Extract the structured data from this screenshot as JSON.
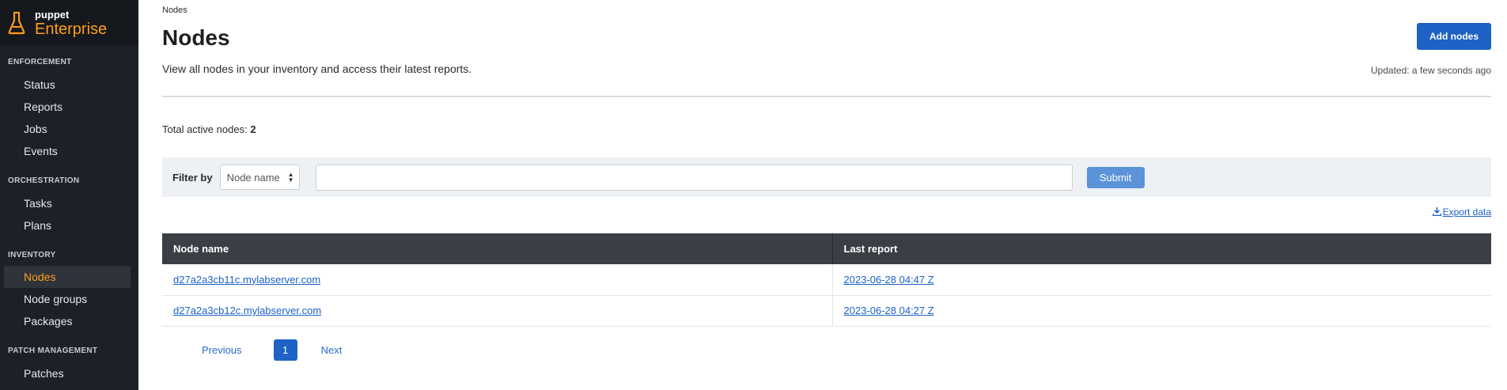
{
  "brand": {
    "small": "puppet",
    "big": "Enterprise",
    "accent": "#ff9c1a"
  },
  "sidebar": {
    "sections": [
      {
        "title": "ENFORCEMENT",
        "items": [
          "Status",
          "Reports",
          "Jobs",
          "Events"
        ]
      },
      {
        "title": "ORCHESTRATION",
        "items": [
          "Tasks",
          "Plans"
        ]
      },
      {
        "title": "INVENTORY",
        "items": [
          "Nodes",
          "Node groups",
          "Packages"
        ]
      },
      {
        "title": "PATCH MANAGEMENT",
        "items": [
          "Patches"
        ]
      }
    ],
    "active_item": "Nodes"
  },
  "header": {
    "breadcrumb": "Nodes",
    "title": "Nodes",
    "description": "View all nodes in your inventory and access their latest reports.",
    "add_button": "Add nodes",
    "updated": "Updated: a few seconds ago"
  },
  "summary": {
    "label": "Total active nodes:",
    "count": "2"
  },
  "filter": {
    "label": "Filter by",
    "select_value": "Node name",
    "input_value": "",
    "submit": "Submit"
  },
  "export_label": "Export data",
  "table": {
    "columns": [
      "Node name",
      "Last report"
    ],
    "rows": [
      [
        "d27a2a3cb11c.mylabserver.com",
        "2023-06-28 04:47 Z"
      ],
      [
        "d27a2a3cb12c.mylabserver.com",
        "2023-06-28 04:27 Z"
      ]
    ]
  },
  "pagination": {
    "previous": "Previous",
    "current": "1",
    "next": "Next"
  }
}
